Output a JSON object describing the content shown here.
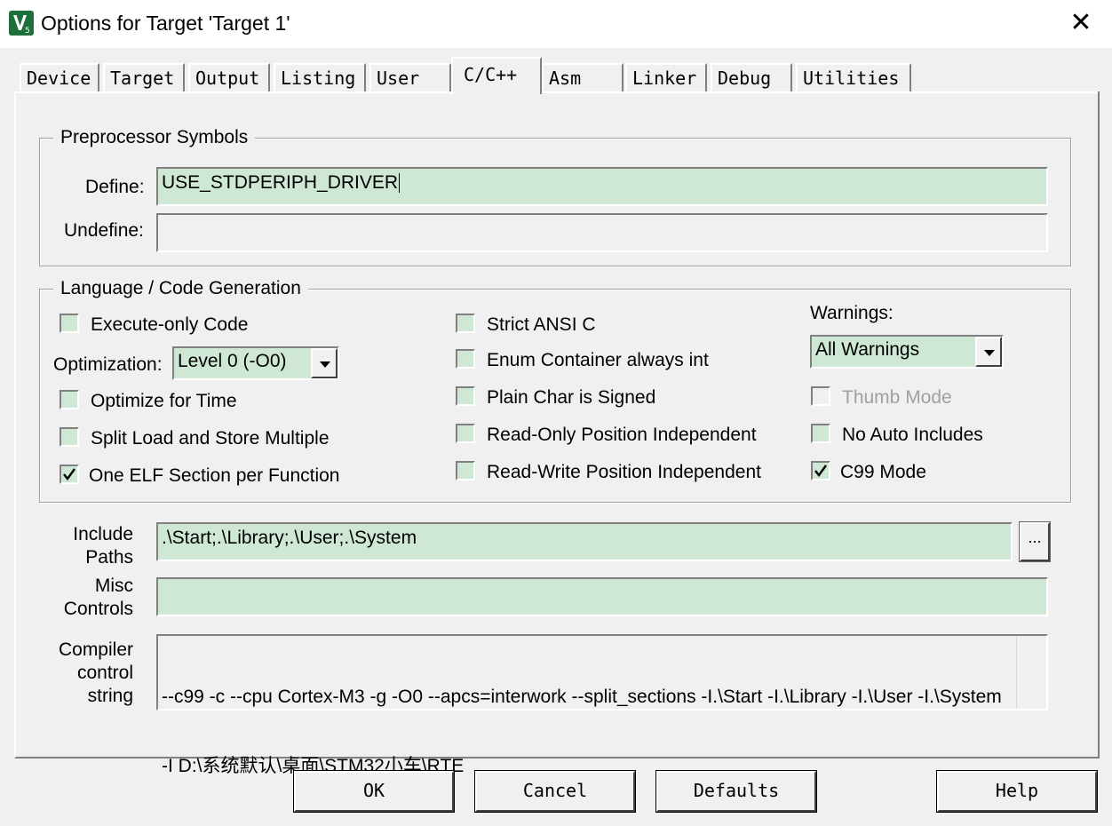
{
  "window": {
    "title": "Options for Target 'Target 1'",
    "close_glyph": "✕",
    "icon_name": "keil-uvision-icon"
  },
  "tabs": [
    {
      "label": "Device"
    },
    {
      "label": "Target"
    },
    {
      "label": "Output"
    },
    {
      "label": "Listing"
    },
    {
      "label": "User"
    },
    {
      "label": "C/C++",
      "active": true
    },
    {
      "label": "Asm"
    },
    {
      "label": "Linker"
    },
    {
      "label": "Debug"
    },
    {
      "label": "Utilities"
    }
  ],
  "preprocessor": {
    "legend": "Preprocessor Symbols",
    "define_label": "Define:",
    "define_value": "USE_STDPERIPH_DRIVER",
    "undefine_label": "Undefine:",
    "undefine_value": ""
  },
  "language": {
    "legend": "Language / Code Generation",
    "execute_only": {
      "label": "Execute-only Code",
      "checked": false
    },
    "optimization_label": "Optimization:",
    "optimization_value": "Level 0 (-O0)",
    "optimize_time": {
      "label": "Optimize for Time",
      "checked": false
    },
    "split_load": {
      "label": "Split Load and Store Multiple",
      "checked": false
    },
    "one_elf": {
      "label": "One ELF Section per Function",
      "checked": true
    },
    "strict_ansi": {
      "label": "Strict ANSI C",
      "checked": false
    },
    "enum_container": {
      "label": "Enum Container always int",
      "checked": false
    },
    "plain_char": {
      "label": "Plain Char is Signed",
      "checked": false
    },
    "ro_pi": {
      "label": "Read-Only Position Independent",
      "checked": false
    },
    "rw_pi": {
      "label": "Read-Write Position Independent",
      "checked": false
    },
    "warnings_label": "Warnings:",
    "warnings_value": "All Warnings",
    "thumb_mode": {
      "label": "Thumb Mode",
      "checked": false,
      "disabled": true
    },
    "no_auto_includes": {
      "label": "No Auto Includes",
      "checked": false
    },
    "c99_mode": {
      "label": "C99 Mode",
      "checked": true
    }
  },
  "include": {
    "label_line1": "Include",
    "label_line2": "Paths",
    "value": ".\\Start;.\\Library;.\\User;.\\System",
    "browse_label": "..."
  },
  "misc": {
    "label_line1": "Misc",
    "label_line2": "Controls",
    "value": ""
  },
  "compiler": {
    "label_line1": "Compiler",
    "label_line2": "control",
    "label_line3": "string",
    "line1": "--c99 -c --cpu Cortex-M3 -g -O0 --apcs=interwork --split_sections -I.\\Start -I.\\Library -I.\\User -I.\\System",
    "line2": "-I D:\\系统默认\\桌面\\STM32小车\\RTE"
  },
  "buttons": {
    "ok": "OK",
    "cancel": "Cancel",
    "defaults": "Defaults",
    "help": "Help"
  },
  "colors": {
    "field_bg": "#cfe8d5",
    "dialog_bg": "#f0f0f0"
  }
}
